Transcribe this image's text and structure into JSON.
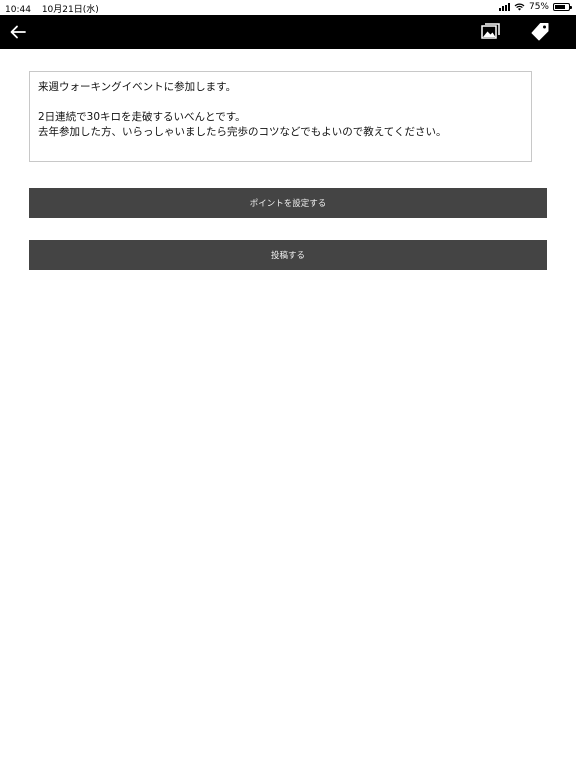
{
  "status_bar": {
    "time": "10:44",
    "date": "10月21日(水)",
    "battery_percent": "75%",
    "battery_level": 0.75
  },
  "nav": {
    "back_icon": "arrow-left-icon",
    "image_icon": "images-icon",
    "tag_icon": "tag-icon",
    "background": "#000000"
  },
  "post": {
    "lines": [
      "来週ウォーキングイベントに参加します。",
      "",
      "2日連続で30キロを走破するいべんとです。",
      "去年参加した方、いらっしゃいましたら完歩のコツなどでもよいので教えてください。"
    ]
  },
  "buttons": {
    "set_points": "ポイントを設定する",
    "submit": "投稿する",
    "color": "#444444"
  }
}
